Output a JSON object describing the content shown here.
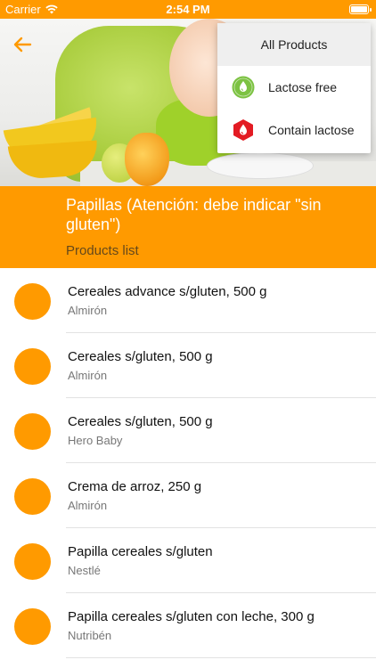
{
  "status_bar": {
    "carrier": "Carrier",
    "time": "2:54 PM"
  },
  "header": {
    "back_icon": "arrow-left-icon"
  },
  "filter_menu": {
    "items": [
      {
        "label": "All Products",
        "selected": true
      },
      {
        "label": "Lactose free",
        "icon": "drop-icon",
        "color": "#7cc242"
      },
      {
        "label": "Contain lactose",
        "icon": "drop-icon",
        "color": "#e31b23"
      }
    ]
  },
  "category": {
    "title": "Papillas (Atención: debe indicar \"sin gluten\")",
    "subtitle": "Products list"
  },
  "accent_color": "#ff9a00",
  "products": [
    {
      "name": "Cereales advance s/gluten, 500 g",
      "brand": "Almirón"
    },
    {
      "name": "Cereales s/gluten, 500 g",
      "brand": "Almirón"
    },
    {
      "name": "Cereales s/gluten, 500 g",
      "brand": "Hero Baby"
    },
    {
      "name": "Crema de arroz, 250 g",
      "brand": "Almirón"
    },
    {
      "name": "Papilla cereales s/gluten",
      "brand": "Nestlé"
    },
    {
      "name": "Papilla cereales s/gluten con leche, 300 g",
      "brand": "Nutribén"
    }
  ]
}
